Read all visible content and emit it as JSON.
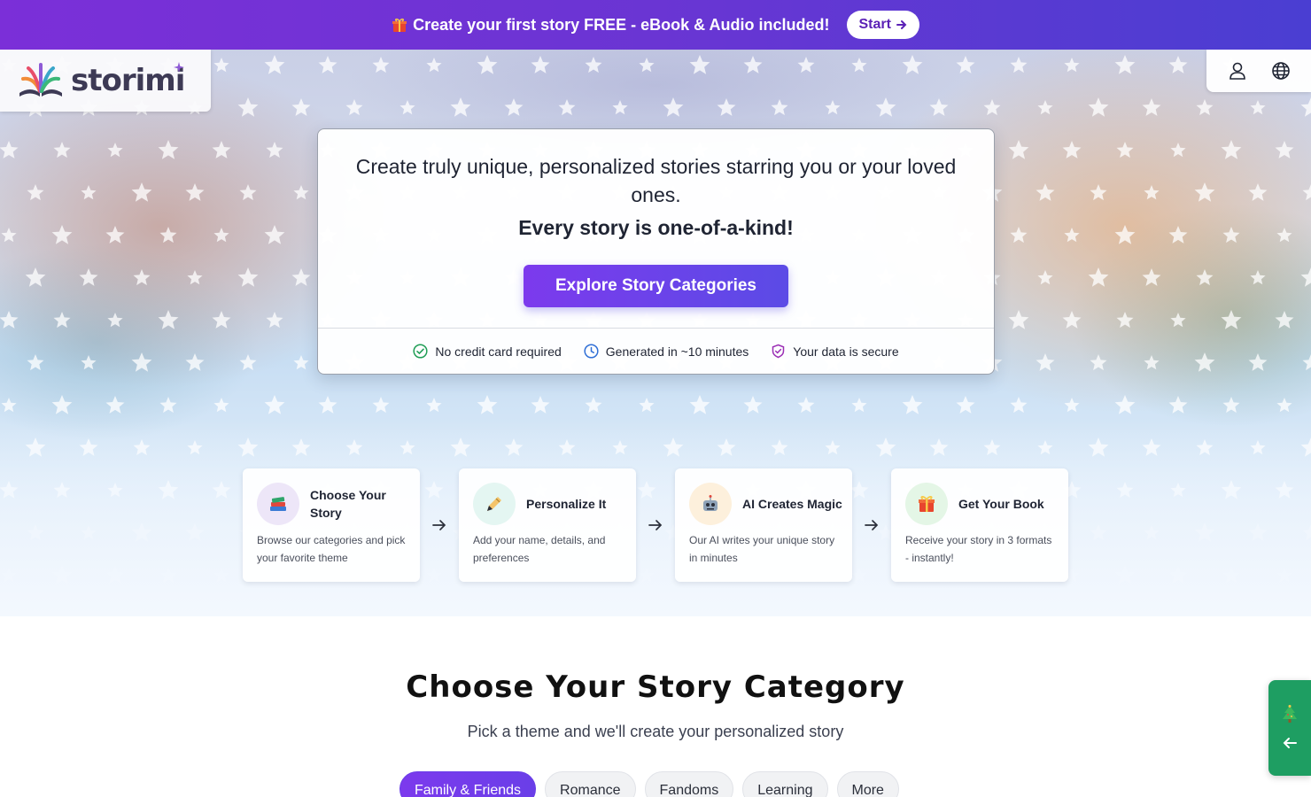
{
  "promo": {
    "text": "Create your first story FREE - eBook & Audio included!",
    "button_label": "Start"
  },
  "brand": {
    "name": "storimi"
  },
  "hero": {
    "tagline": "Create truly unique, personalized stories starring you or your loved ones.",
    "tagline_bold": "Every story is one-of-a-kind!",
    "cta_label": "Explore Story Categories",
    "features": [
      {
        "label": "No credit card required",
        "icon": "check-circle-icon"
      },
      {
        "label": "Generated in ~10 minutes",
        "icon": "clock-icon"
      },
      {
        "label": "Your data is secure",
        "icon": "shield-check-icon"
      }
    ]
  },
  "steps": [
    {
      "title": "Choose Your Story",
      "desc": "Browse our categories and pick your favorite theme",
      "icon": "books-icon",
      "icon_bg": "#ede6f8"
    },
    {
      "title": "Personalize It",
      "desc": "Add your name, details, and preferences",
      "icon": "writing-hand-icon",
      "icon_bg": "#e4f6f2"
    },
    {
      "title": "AI Creates Magic",
      "desc": "Our AI writes your unique story in minutes",
      "icon": "robot-icon",
      "icon_bg": "#fdf0dc"
    },
    {
      "title": "Get Your Book",
      "desc": "Receive your story in 3 formats - instantly!",
      "icon": "gift-icon",
      "icon_bg": "#e4f6e6"
    }
  ],
  "category_section": {
    "title": "Choose Your Story Category",
    "subtitle": "Pick a theme and we'll create your personalized story",
    "tabs": [
      {
        "label": "Family & Friends",
        "active": true
      },
      {
        "label": "Romance",
        "active": false
      },
      {
        "label": "Fandoms",
        "active": false
      },
      {
        "label": "Learning",
        "active": false
      },
      {
        "label": "More",
        "active": false
      }
    ]
  },
  "colors": {
    "accent": "#7c3aed",
    "promo_start": "#7b2fd8",
    "promo_end": "#4a3ed2",
    "side_widget": "#1e9e62"
  }
}
